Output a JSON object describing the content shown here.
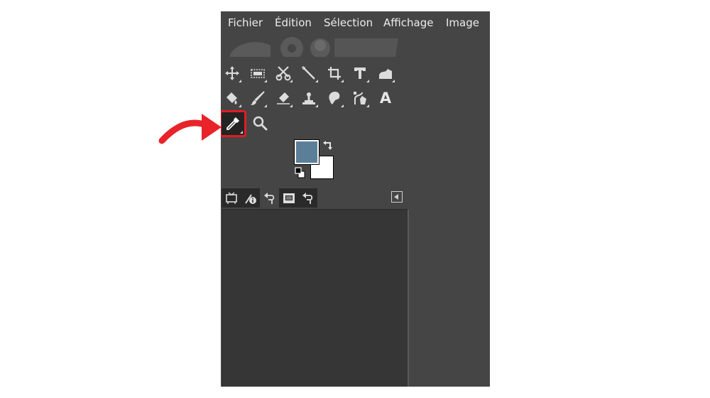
{
  "menubar": {
    "items": [
      {
        "label": "Fichier"
      },
      {
        "label": "Édition"
      },
      {
        "label": "Sélection"
      },
      {
        "label": "Affichage"
      },
      {
        "label": "Image"
      }
    ]
  },
  "toolbox": {
    "rows": [
      [
        "move-tool-icon",
        "rect-select-tool-icon",
        "scissors-select-tool-icon",
        "fuzzy-select-tool-icon",
        "crop-tool-icon",
        "unified-transform-tool-icon",
        "warp-transform-tool-icon"
      ],
      [
        "bucket-fill-tool-icon",
        "paintbrush-tool-icon",
        "eraser-tool-icon",
        "clone-tool-icon",
        "smudge-tool-icon",
        "paths-tool-icon",
        "text-tool-icon"
      ],
      [
        "color-picker-tool-icon",
        "zoom-tool-icon"
      ]
    ],
    "text_tool_glyph": "A",
    "active_tool": "color-picker-tool-icon"
  },
  "colors": {
    "foreground": "#5b7f99",
    "background": "#ffffff",
    "panel": "#454545",
    "highlight": "#e01b24"
  },
  "dock_tabs": [
    "tool-options-icon",
    "device-status-icon",
    "undo-history-icon",
    "images-icon",
    "undo-history-icon"
  ],
  "annotation": {
    "arrow_color": "#e8232a"
  }
}
